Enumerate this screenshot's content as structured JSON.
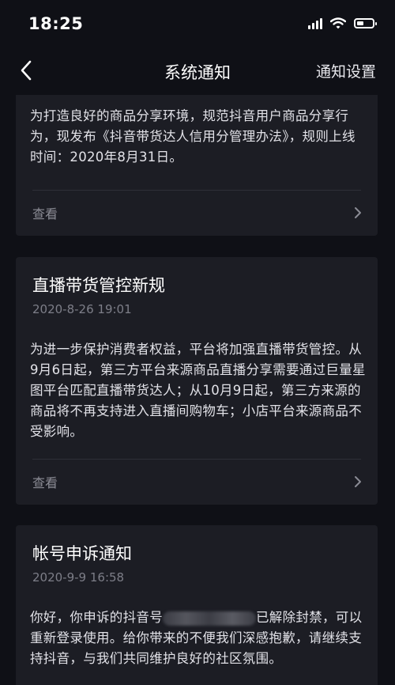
{
  "status": {
    "time": "18:25"
  },
  "nav": {
    "title": "系统通知",
    "settings_label": "通知设置"
  },
  "notices": [
    {
      "title": "",
      "date": "",
      "body": "为打造良好的商品分享环境，规范抖音用户商品分享行为，现发布《抖音带货达人信用分管理办法》，规则上线时间：2020年8月31日。",
      "view_label": "查看"
    },
    {
      "title": "直播带货管控新规",
      "date": "2020-8-26 19:01",
      "body": "为进一步保护消费者权益，平台将加强直播带货管控。从9月6日起，第三方平台来源商品直播分享需要通过巨量星图平台匹配直播带货达人；从10月9日起，第三方来源的商品将不再支持进入直播间购物车；小店平台来源商品不受影响。",
      "view_label": "查看"
    },
    {
      "title": "帐号申诉通知",
      "date": "2020-9-9 16:58",
      "body_start": "你好，你申诉的抖音号",
      "body_end": "已解除封禁，可以重新登录使用。给你带来的不便我们深感抱歉，请继续支持抖音，与我们共同维护良好的社区氛围。"
    }
  ],
  "colors": {
    "background": "#0f1016",
    "card": "#1c1d24",
    "secondary_text": "#7d7e88"
  }
}
